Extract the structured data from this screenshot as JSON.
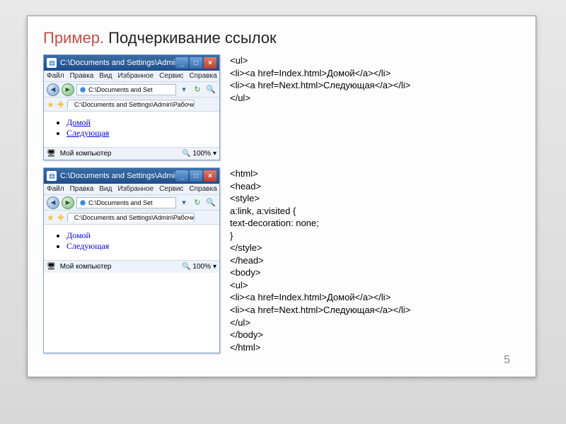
{
  "title_accent": "Пример.",
  "title_rest": " Подчеркивание ссылок",
  "window": {
    "title": "C:\\Documents and Settings\\Admin\\P...",
    "menus": [
      "Файл",
      "Правка",
      "Вид",
      "Избранное",
      "Сервис",
      "Справка"
    ],
    "address": "C:\\Documents and Set",
    "tab": "C:\\Documents and Settings\\Admin\\Рабочий с...",
    "status": "Мой компьютер",
    "zoom": "100%",
    "links": [
      "Домой",
      "Следующая"
    ]
  },
  "code1": "<ul>\n<li><a href=Index.html>Домой</a></li>\n<li><a href=Next.html>Следующая</a></li>\n</ul>",
  "code2": "<html>\n<head>\n<style>\na:link, a:visited {\ntext-decoration: none;\n}\n</style>\n</head>\n<body>\n<ul>\n<li><a href=Index.html>Домой</a></li>\n<li><a href=Next.html>Следующая</a></li>\n</ul>\n</body>\n</html>",
  "page_number": "5"
}
